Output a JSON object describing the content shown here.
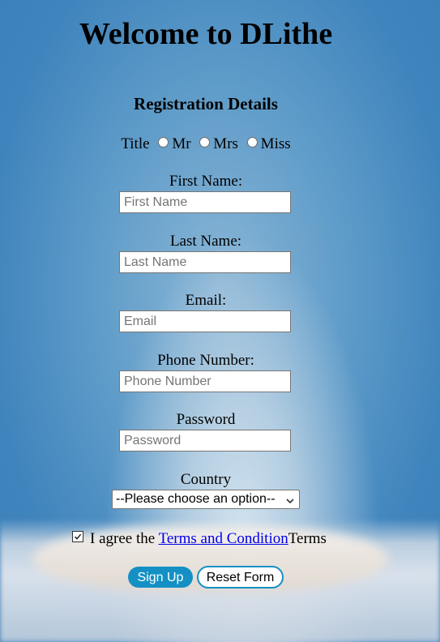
{
  "page": {
    "title": "Welcome to DLithe",
    "subtitle": "Registration Details"
  },
  "title_group": {
    "label": "Title",
    "options": [
      "Mr",
      "Mrs",
      "Miss"
    ]
  },
  "fields": {
    "first_name": {
      "label": "First Name:",
      "placeholder": "First Name",
      "value": ""
    },
    "last_name": {
      "label": "Last Name:",
      "placeholder": "Last Name",
      "value": ""
    },
    "email": {
      "label": "Email:",
      "placeholder": "Email",
      "value": ""
    },
    "phone": {
      "label": "Phone Number:",
      "placeholder": "Phone Number",
      "value": ""
    },
    "password": {
      "label": "Password",
      "placeholder": "Password",
      "value": ""
    }
  },
  "country": {
    "label": "Country",
    "selected": "--Please choose an option--"
  },
  "agree": {
    "checked": true,
    "prefix": "I agree the ",
    "link_text": "Terms and Condition",
    "suffix": "Terms"
  },
  "buttons": {
    "signup": "Sign Up",
    "reset": "Reset Form"
  },
  "colors": {
    "button_accent": "#1490c4",
    "link": "#0000ee"
  },
  "icons": {
    "select_chevron": "chevron-down-icon",
    "checkbox": "checkmark-icon"
  }
}
